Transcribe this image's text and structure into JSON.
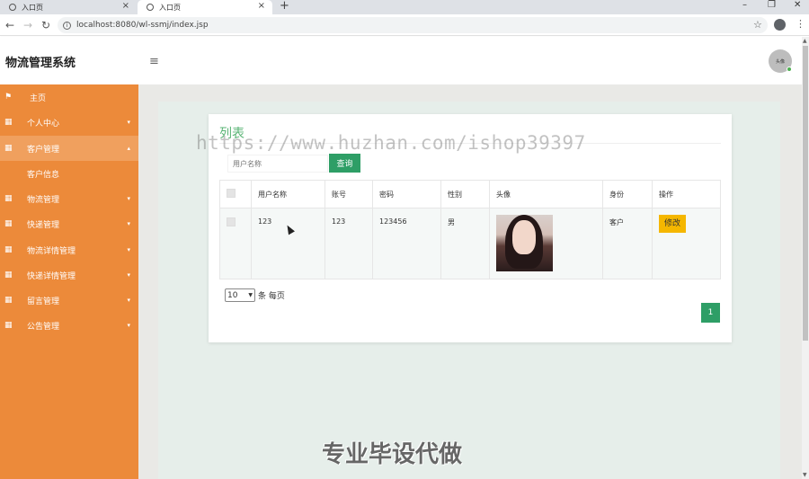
{
  "browser": {
    "tabs": [
      {
        "label": "入口页"
      },
      {
        "label": "入口页"
      }
    ],
    "url": "localhost:8080/wl-ssmj/index.jsp"
  },
  "header": {
    "brand": "物流管理系统",
    "avatar_text": "头像"
  },
  "sidebar": {
    "items": [
      {
        "label": "主页",
        "icon": "flag-icon"
      },
      {
        "label": "个人中心",
        "icon": "grid-icon"
      },
      {
        "label": "客户管理",
        "icon": "grid-icon"
      },
      {
        "label": "客户信息"
      },
      {
        "label": "物流管理",
        "icon": "grid-icon"
      },
      {
        "label": "快递管理",
        "icon": "grid-icon"
      },
      {
        "label": "物流详情管理",
        "icon": "grid-icon"
      },
      {
        "label": "快递详情管理",
        "icon": "grid-icon"
      },
      {
        "label": "留言管理",
        "icon": "grid-icon"
      },
      {
        "label": "公告管理",
        "icon": "grid-icon"
      }
    ],
    "color": "#ec8a3a"
  },
  "main": {
    "title": "列表",
    "search_placeholder": "用户名称",
    "query_label": "查询",
    "table": {
      "headers": [
        "",
        "用户名称",
        "账号",
        "密码",
        "性别",
        "头像",
        "身份",
        "操作"
      ],
      "rows": [
        {
          "username": "123",
          "account": "123",
          "password": "123456",
          "gender": "男",
          "role": "客户",
          "action": "修改"
        }
      ]
    },
    "page_size": "10",
    "per_page_label": "条 每页",
    "current_page": "1",
    "accent": "#2e9e66"
  },
  "overlay": {
    "watermark": "https://www.huzhan.com/ishop39397",
    "promo": "专业毕设代做"
  }
}
